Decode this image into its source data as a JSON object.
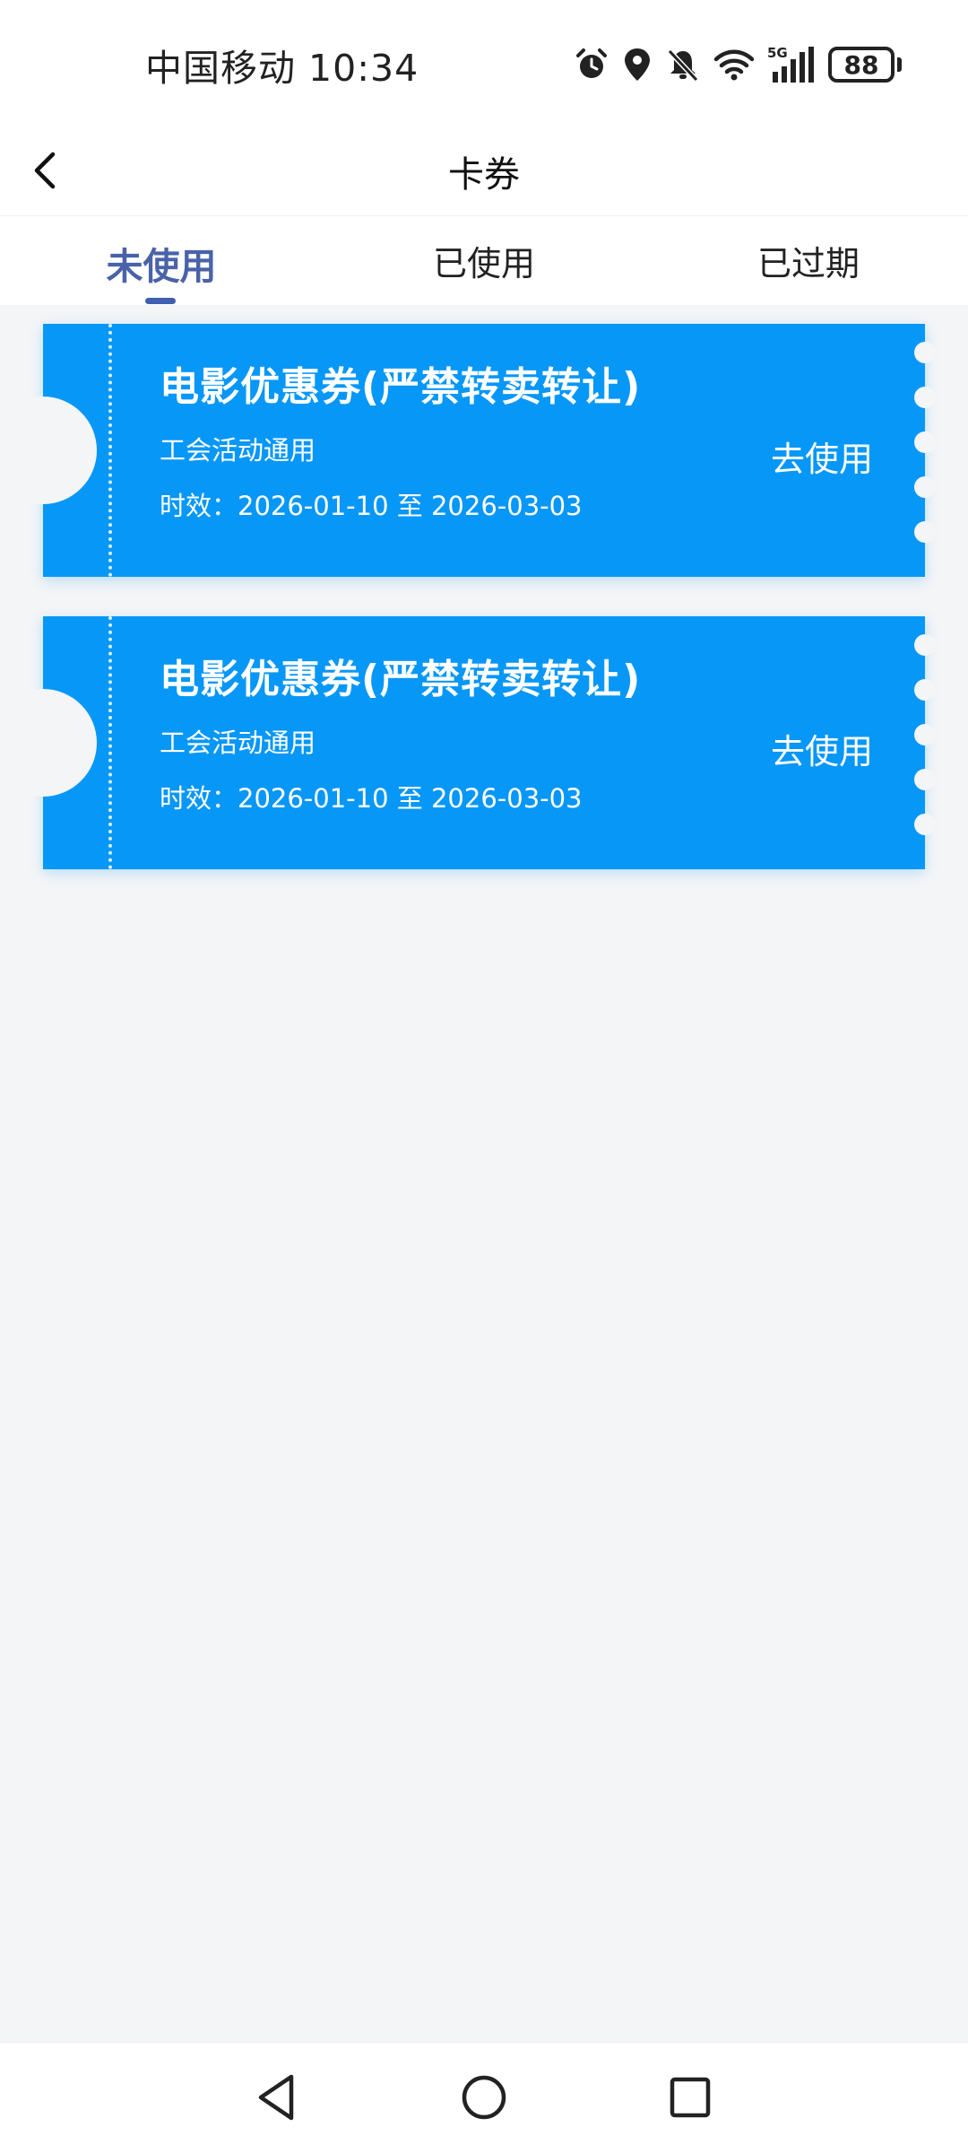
{
  "status_bar": {
    "carrier": "中国移动",
    "time": "10:34",
    "network": "5G",
    "battery": "88",
    "icons": [
      "alarm-icon",
      "location-icon",
      "bell-muted-icon",
      "wifi-icon",
      "signal-icon",
      "battery-icon"
    ]
  },
  "header": {
    "title": "卡券",
    "back_icon": "chevron-left-icon"
  },
  "tabs": [
    {
      "label": "未使用",
      "active": true
    },
    {
      "label": "已使用",
      "active": false
    },
    {
      "label": "已过期",
      "active": false
    }
  ],
  "coupons": [
    {
      "title": "电影优惠券(严禁转卖转让)",
      "subtitle": "工会活动通用",
      "validity": "时效：2026-01-10 至 2026-03-03",
      "action": "去使用"
    },
    {
      "title": "电影优惠券(严禁转卖转让)",
      "subtitle": "工会活动通用",
      "validity": "时效：2026-01-10 至 2026-03-03",
      "action": "去使用"
    }
  ],
  "nav_bar": [
    "back-triangle-icon",
    "home-circle-icon",
    "recents-square-icon"
  ],
  "colors": {
    "coupon_bg": "#0797f7",
    "tab_active": "#4a63a8",
    "page_bg": "#f4f5f7"
  }
}
